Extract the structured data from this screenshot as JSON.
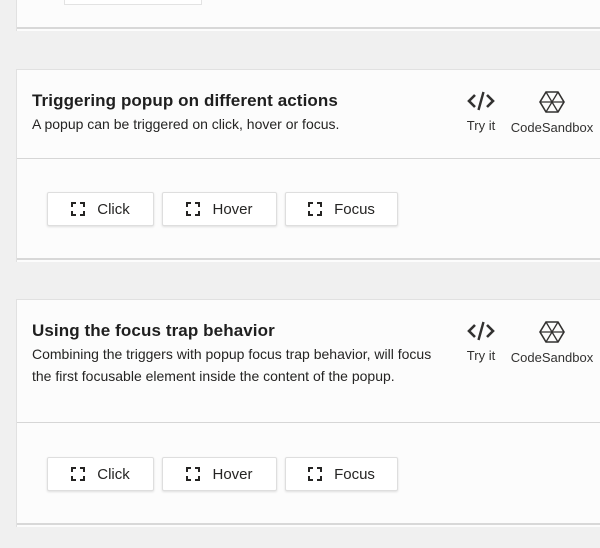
{
  "sections": [
    {
      "title": "Triggering popup on different actions",
      "description": "A popup can be triggered on click, hover or focus.",
      "actions": {
        "try_it": "Try it",
        "codesandbox": "CodeSandbox"
      },
      "buttons": [
        {
          "label": "Click",
          "icon": "expand-icon"
        },
        {
          "label": "Hover",
          "icon": "expand-icon"
        },
        {
          "label": "Focus",
          "icon": "expand-icon"
        }
      ]
    },
    {
      "title": "Using the focus trap behavior",
      "description": "Combining the triggers with popup focus trap behavior, will focus the first focusable element inside the content of the popup.",
      "actions": {
        "try_it": "Try it",
        "codesandbox": "CodeSandbox"
      },
      "buttons": [
        {
          "label": "Click",
          "icon": "expand-icon"
        },
        {
          "label": "Hover",
          "icon": "expand-icon"
        },
        {
          "label": "Focus",
          "icon": "expand-icon"
        }
      ]
    }
  ],
  "icons": {
    "try_it": "code-icon",
    "codesandbox": "codesandbox-cube-icon"
  }
}
